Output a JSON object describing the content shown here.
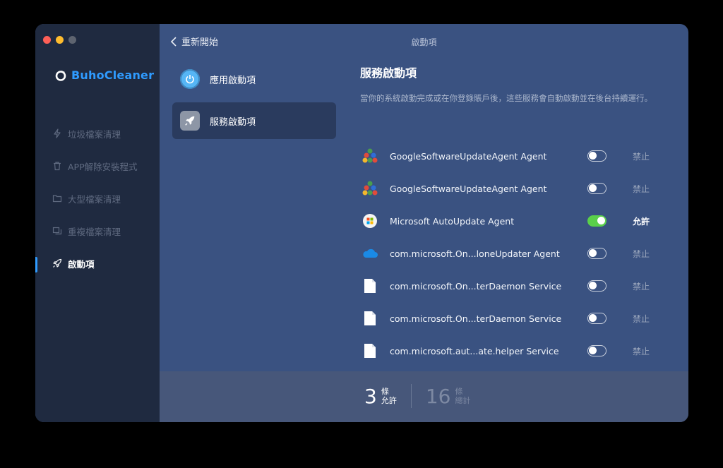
{
  "app": {
    "name": "BuhoCleaner"
  },
  "sidebar": {
    "items": [
      {
        "label": "垃圾檔案清理",
        "icon": "bolt-icon"
      },
      {
        "label": "APP解除安裝程式",
        "icon": "trash-icon"
      },
      {
        "label": "大型檔案清理",
        "icon": "folder-icon"
      },
      {
        "label": "重複檔案清理",
        "icon": "duplicate-icon"
      },
      {
        "label": "啟動項",
        "icon": "rocket-icon"
      }
    ],
    "active": "啟動項"
  },
  "topbar": {
    "back_label": "重新開始",
    "title": "啟動項"
  },
  "subnav": {
    "items": [
      {
        "label": "應用啟動項",
        "icon": "power-icon"
      },
      {
        "label": "服務啟動項",
        "icon": "rocket-icon"
      }
    ]
  },
  "content": {
    "title": "服務啟動項",
    "description": "當你的系統啟動完成或在你登錄賬戶後，這些服務會自動啟動並在後台持續運行。"
  },
  "services": [
    {
      "name": "GoogleSoftwareUpdateAgent Agent",
      "icon": "google-update-icon",
      "enabled": false,
      "status": "禁止"
    },
    {
      "name": "GoogleSoftwareUpdateAgent Agent",
      "icon": "google-update-icon",
      "enabled": false,
      "status": "禁止"
    },
    {
      "name": "Microsoft AutoUpdate Agent",
      "icon": "microsoft-autoupdate-icon",
      "enabled": true,
      "status": "允許"
    },
    {
      "name": "com.microsoft.On...loneUpdater Agent",
      "icon": "onedrive-icon",
      "enabled": false,
      "status": "禁止"
    },
    {
      "name": "com.microsoft.On...terDaemon Service",
      "icon": "file-icon",
      "enabled": false,
      "status": "禁止"
    },
    {
      "name": "com.microsoft.On...terDaemon Service",
      "icon": "file-icon",
      "enabled": false,
      "status": "禁止"
    },
    {
      "name": "com.microsoft.aut...ate.helper Service",
      "icon": "file-icon",
      "enabled": false,
      "status": "禁止"
    }
  ],
  "footer": {
    "allowed": {
      "count": "3",
      "unit": "條",
      "label": "允許"
    },
    "total": {
      "count": "16",
      "unit": "條",
      "label": "總計"
    }
  },
  "colors": {
    "accent": "#2f9bff",
    "toggle_on": "#5ad04a",
    "sidebar_bg": "#1f2a40",
    "main_bg": "#3a5281"
  }
}
